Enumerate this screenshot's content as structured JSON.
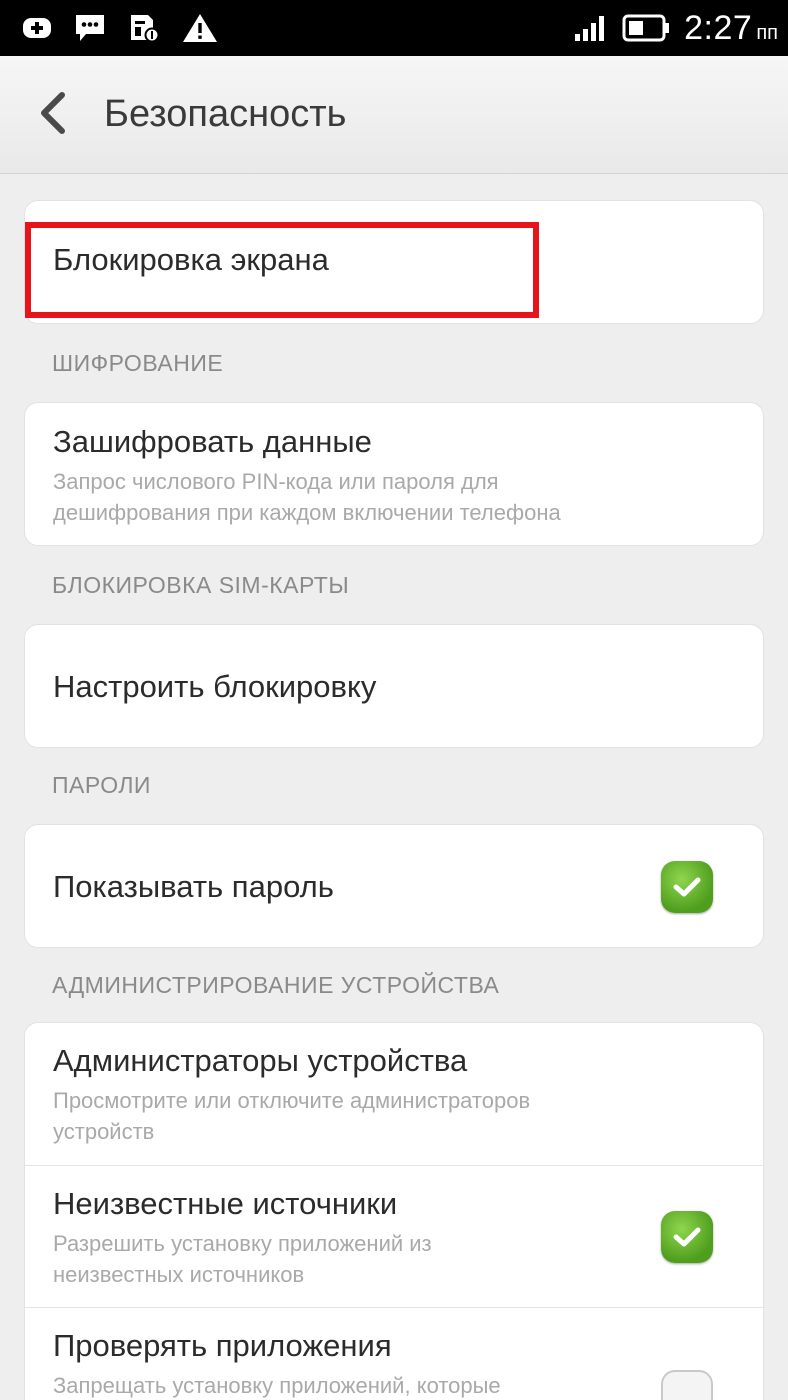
{
  "status_bar": {
    "time": "2:27",
    "ampm": "пп",
    "icons": [
      "notification-plus-icon",
      "message-icon",
      "sim-card-icon",
      "warning-icon"
    ]
  },
  "header": {
    "title": "Безопасность"
  },
  "screen_lock": {
    "title": "Блокировка экрана"
  },
  "encryption": {
    "section": "ШИФРОВАНИЕ",
    "title": "Зашифровать данные",
    "subtitle_line1": "Запрос числового PIN-кода или пароля для",
    "subtitle_line2": "дешифрования при каждом включении телефона"
  },
  "sim_lock": {
    "section": "БЛОКИРОВКА SIM-КАРТЫ",
    "title": "Настроить блокировку"
  },
  "passwords": {
    "section": "ПАРОЛИ",
    "title": "Показывать пароль",
    "checked": true
  },
  "device_admin": {
    "section": "АДМИНИСТРИРОВАНИЕ УСТРОЙСТВА",
    "items": [
      {
        "title": "Администраторы устройства",
        "subtitle_line1": "Просмотрите или отключите администраторов",
        "subtitle_line2": "устройств"
      },
      {
        "title": "Неизвестные источники",
        "subtitle_line1": "Разрешить установку приложений из",
        "subtitle_line2": "неизвестных источников",
        "checked": true
      },
      {
        "title": "Проверять приложения",
        "subtitle_line1": "Запрещать установку приложений, которые",
        "checked": false
      }
    ]
  },
  "colors": {
    "highlight": "#e8141b",
    "check_green": "#5aab26"
  }
}
